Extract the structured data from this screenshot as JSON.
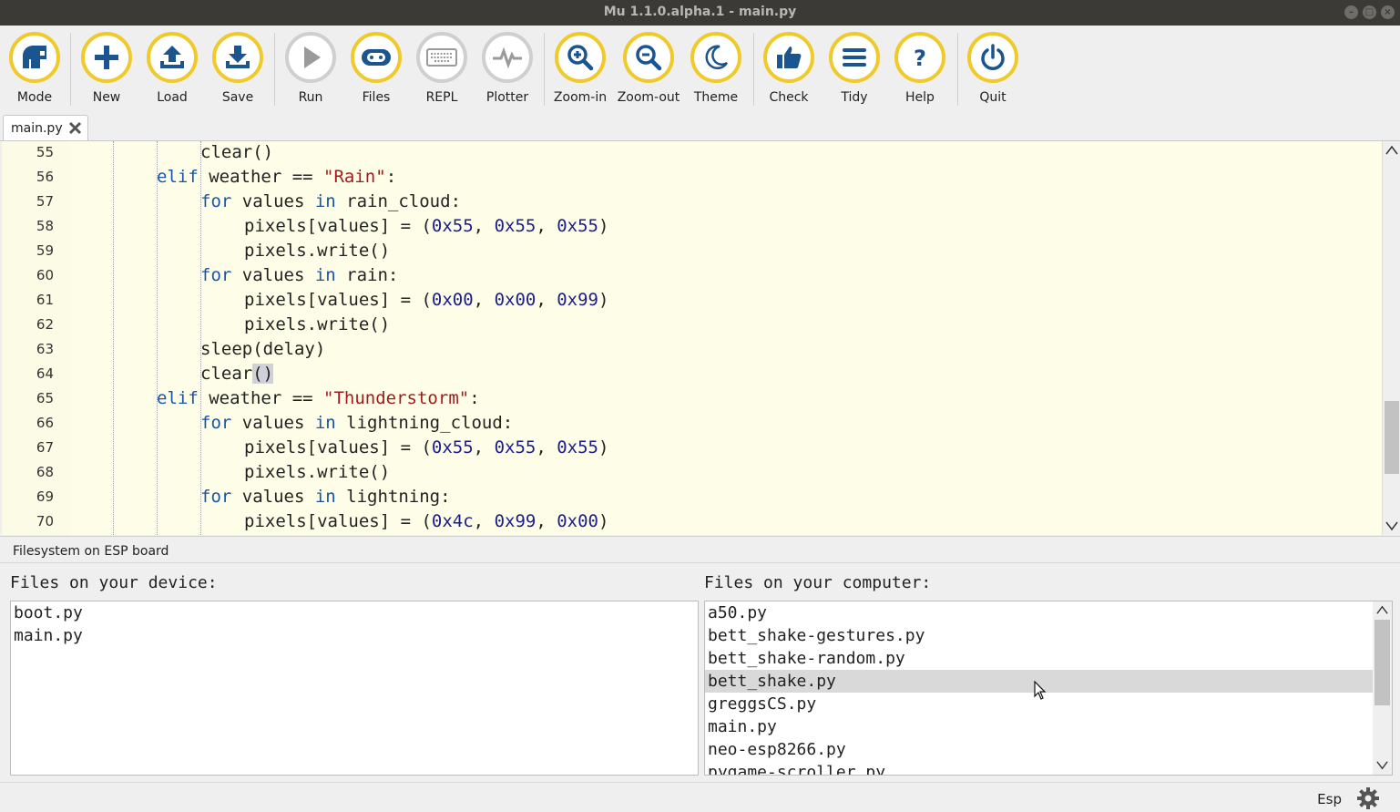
{
  "window": {
    "title": "Mu 1.1.0.alpha.1 - main.py"
  },
  "toolbar": {
    "mode": "Mode",
    "new": "New",
    "load": "Load",
    "save": "Save",
    "run": "Run",
    "files": "Files",
    "repl": "REPL",
    "plotter": "Plotter",
    "zoom_in": "Zoom-in",
    "zoom_out": "Zoom-out",
    "theme": "Theme",
    "check": "Check",
    "tidy": "Tidy",
    "help": "Help",
    "quit": "Quit"
  },
  "tabs": [
    {
      "label": "main.py"
    }
  ],
  "editor": {
    "lines": [
      {
        "num": "55",
        "indent": 3,
        "tokens": [
          [
            "clear()",
            "id"
          ]
        ]
      },
      {
        "num": "56",
        "indent": 2,
        "tokens": [
          [
            "elif",
            "kw"
          ],
          [
            " weather == ",
            "id"
          ],
          [
            "\"Rain\"",
            "str"
          ],
          [
            ":",
            "id"
          ]
        ]
      },
      {
        "num": "57",
        "indent": 3,
        "tokens": [
          [
            "for",
            "kw"
          ],
          [
            " values ",
            "id"
          ],
          [
            "in",
            "kw"
          ],
          [
            " rain_cloud:",
            "id"
          ]
        ]
      },
      {
        "num": "58",
        "indent": 4,
        "tokens": [
          [
            "pixels[values] = (",
            "id"
          ],
          [
            "0x55",
            "num"
          ],
          [
            ", ",
            "id"
          ],
          [
            "0x55",
            "num"
          ],
          [
            ", ",
            "id"
          ],
          [
            "0x55",
            "num"
          ],
          [
            ")",
            "id"
          ]
        ]
      },
      {
        "num": "59",
        "indent": 4,
        "tokens": [
          [
            "pixels.write()",
            "id"
          ]
        ]
      },
      {
        "num": "60",
        "indent": 3,
        "tokens": [
          [
            "for",
            "kw"
          ],
          [
            " values ",
            "id"
          ],
          [
            "in",
            "kw"
          ],
          [
            " rain:",
            "id"
          ]
        ]
      },
      {
        "num": "61",
        "indent": 4,
        "tokens": [
          [
            "pixels[values] = (",
            "id"
          ],
          [
            "0x00",
            "num"
          ],
          [
            ", ",
            "id"
          ],
          [
            "0x00",
            "num"
          ],
          [
            ", ",
            "id"
          ],
          [
            "0x99",
            "num"
          ],
          [
            ")",
            "id"
          ]
        ]
      },
      {
        "num": "62",
        "indent": 4,
        "tokens": [
          [
            "pixels.write()",
            "id"
          ]
        ]
      },
      {
        "num": "63",
        "indent": 3,
        "tokens": [
          [
            "sleep(delay)",
            "id"
          ]
        ]
      },
      {
        "num": "64",
        "indent": 3,
        "tokens": [
          [
            "clear",
            "id"
          ],
          [
            "()",
            "hl"
          ]
        ]
      },
      {
        "num": "65",
        "indent": 2,
        "tokens": [
          [
            "elif",
            "kw"
          ],
          [
            " weather == ",
            "id"
          ],
          [
            "\"Thunderstorm\"",
            "str"
          ],
          [
            ":",
            "id"
          ]
        ]
      },
      {
        "num": "66",
        "indent": 3,
        "tokens": [
          [
            "for",
            "kw"
          ],
          [
            " values ",
            "id"
          ],
          [
            "in",
            "kw"
          ],
          [
            " lightning_cloud:",
            "id"
          ]
        ]
      },
      {
        "num": "67",
        "indent": 4,
        "tokens": [
          [
            "pixels[values] = (",
            "id"
          ],
          [
            "0x55",
            "num"
          ],
          [
            ", ",
            "id"
          ],
          [
            "0x55",
            "num"
          ],
          [
            ", ",
            "id"
          ],
          [
            "0x55",
            "num"
          ],
          [
            ")",
            "id"
          ]
        ]
      },
      {
        "num": "68",
        "indent": 4,
        "tokens": [
          [
            "pixels.write()",
            "id"
          ]
        ]
      },
      {
        "num": "69",
        "indent": 3,
        "tokens": [
          [
            "for",
            "kw"
          ],
          [
            " values ",
            "id"
          ],
          [
            "in",
            "kw"
          ],
          [
            " lightning:",
            "id"
          ]
        ]
      },
      {
        "num": "70",
        "indent": 4,
        "tokens": [
          [
            "pixels[values] = (",
            "id"
          ],
          [
            "0x4c",
            "num"
          ],
          [
            ", ",
            "id"
          ],
          [
            "0x99",
            "num"
          ],
          [
            ", ",
            "id"
          ],
          [
            "0x00",
            "num"
          ],
          [
            ")",
            "id"
          ]
        ]
      }
    ]
  },
  "filesystem": {
    "title": "Filesystem on ESP board",
    "device_label": "Files on your device:",
    "computer_label": "Files on your computer:",
    "device_files": [
      "boot.py",
      "main.py"
    ],
    "computer_files": [
      "a50.py",
      "bett_shake-gestures.py",
      "bett_shake-random.py",
      "bett_shake.py",
      "greggsCS.py",
      "main.py",
      "neo-esp8266.py",
      "pygame-scroller.py"
    ],
    "selected_computer_file": "bett_shake.py"
  },
  "statusbar": {
    "mode": "Esp"
  },
  "colors": {
    "accent": "#f0c92b",
    "editor_bg": "#fefee8",
    "keyword": "#1a55a5",
    "string": "#9f1a1a"
  }
}
